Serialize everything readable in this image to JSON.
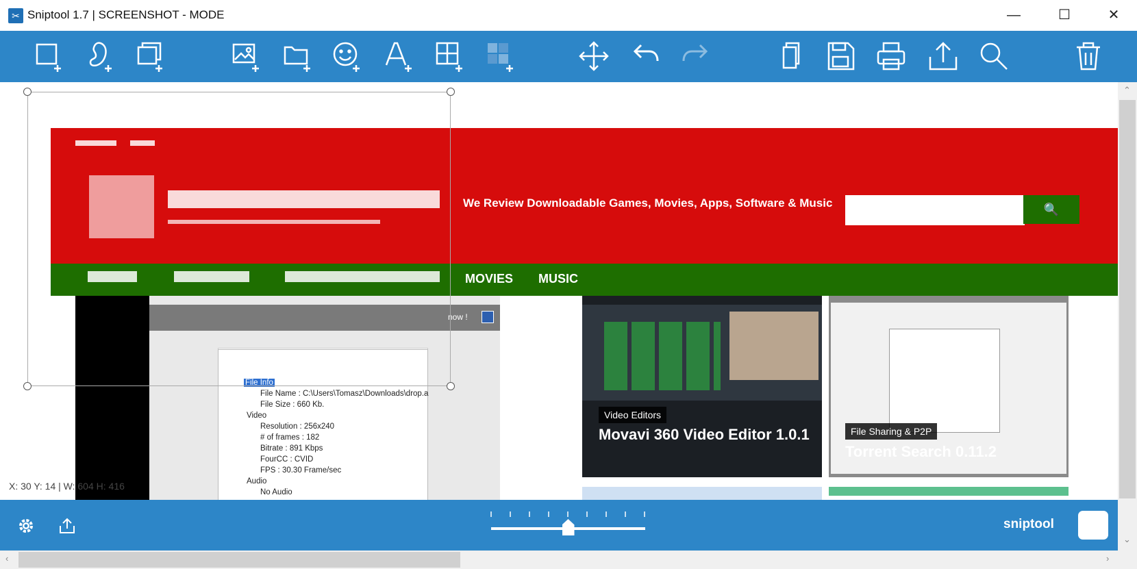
{
  "window": {
    "title": "Sniptool 1.7  |  SCREENSHOT - MODE",
    "minimize": "—",
    "maximize": "☐",
    "close": "✕"
  },
  "toolbar": {
    "tools": [
      "rectangle-select",
      "freeform-select",
      "window-select",
      "add-image",
      "add-folder",
      "add-emoji",
      "add-text",
      "add-grid",
      "add-blur",
      "move",
      "undo",
      "redo",
      "copy",
      "save",
      "print",
      "share",
      "zoom",
      "delete"
    ]
  },
  "website": {
    "tagline": "We Review Downloadable Games, Movies, Apps, Software & Music",
    "search_button": "🔍",
    "nav": [
      "MOVIES",
      "MUSIC"
    ],
    "left_shot": {
      "window_text": "now !",
      "tree": [
        "File Info",
        "File Name : C:\\Users\\Tomasz\\Downloads\\drop.a",
        "File Size : 660 Kb.",
        "Video",
        "Resolution : 256x240",
        "# of frames : 182",
        "Bitrate : 891 Kbps",
        "FourCC : CVID",
        "FPS : 30.30 Frame/sec",
        "Audio",
        "No Audio"
      ]
    },
    "cards": [
      {
        "badge": "Video Editors",
        "title": "Movavi 360 Video Editor 1.0.1"
      },
      {
        "badge": "File Sharing & P2P",
        "title": "Torrent Search 0.11.2"
      }
    ]
  },
  "status": {
    "coords": "X: 30 Y: 14   |   W: 604 H: 416"
  },
  "bottombar": {
    "brand": "sniptool",
    "zoom_level_fraction": 0.5
  },
  "colors": {
    "accent": "#2d86c8",
    "site_red": "#d60c0c",
    "site_green": "#1e6e00"
  }
}
